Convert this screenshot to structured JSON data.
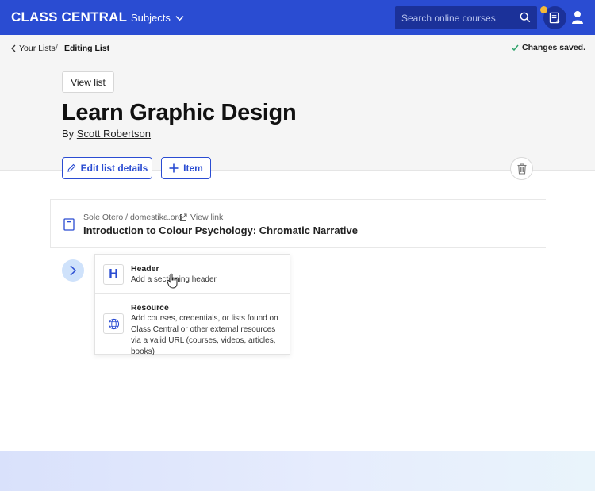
{
  "nav": {
    "logo": "CLASS CENTRAL",
    "subjects": "Subjects",
    "search_placeholder": "Search online courses"
  },
  "breadcrumb": {
    "parent": "Your Lists",
    "separator": "/",
    "current": "Editing List"
  },
  "status": "Changes saved.",
  "view_list_label": "View list",
  "list": {
    "title": "Learn Graphic Design",
    "by_prefix": "By",
    "author": "Scott Robertson"
  },
  "actions": {
    "edit_label": "Edit list details",
    "item_label": "Item"
  },
  "resource": {
    "source": "Sole Otero / domestika.org",
    "view_link": "View link",
    "title": "Introduction to Colour Psychology: Chromatic Narrative"
  },
  "menu": {
    "header_title": "Header",
    "header_desc": "Add a sectioning header",
    "resource_title": "Resource",
    "resource_desc": "Add courses, credentials, or lists found on Class Central or other external resources via a valid URL (courses, videos, articles, books)"
  },
  "colors": {
    "brand": "#2a4cd2",
    "notification": "#f5b936",
    "success": "#2fa36b"
  }
}
